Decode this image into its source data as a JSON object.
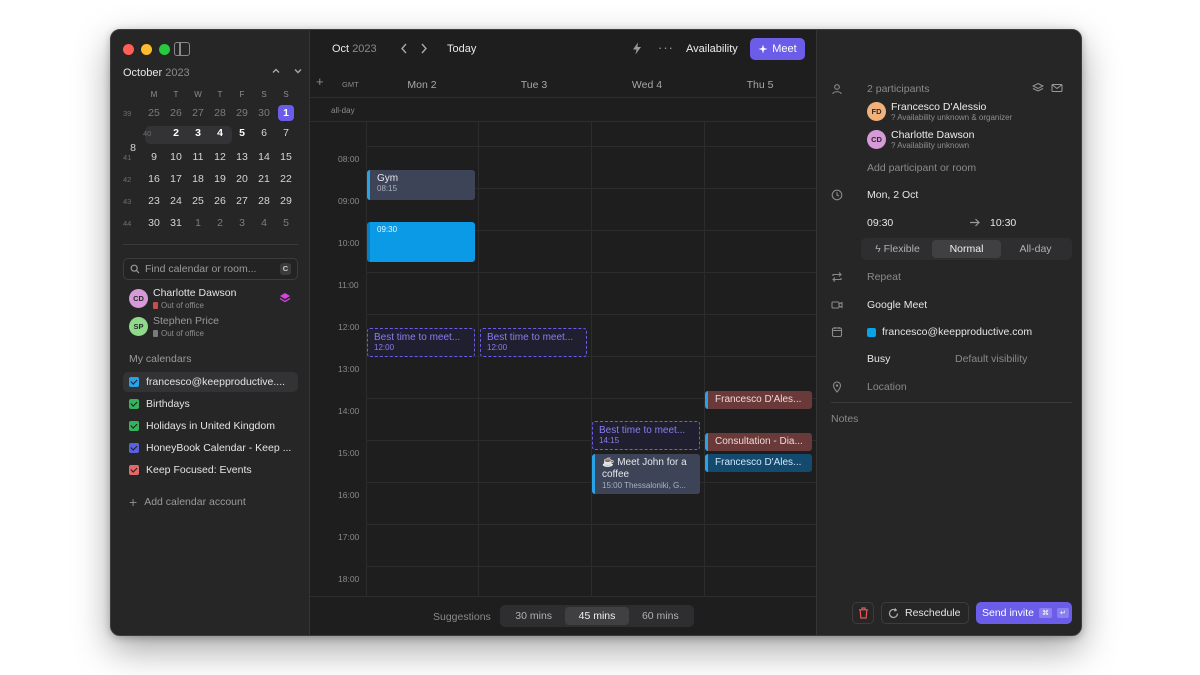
{
  "sidebar": {
    "mini": {
      "month": "October",
      "year": "2023",
      "dows": [
        "M",
        "T",
        "W",
        "T",
        "F",
        "S",
        "S"
      ],
      "weeks": [
        {
          "num": "39",
          "days": [
            "25",
            "26",
            "27",
            "28",
            "29",
            "30",
            "1"
          ]
        },
        {
          "num": "40",
          "days": [
            "2",
            "3",
            "4",
            "5",
            "6",
            "7",
            "8"
          ]
        },
        {
          "num": "41",
          "days": [
            "9",
            "10",
            "11",
            "12",
            "13",
            "14",
            "15"
          ]
        },
        {
          "num": "42",
          "days": [
            "16",
            "17",
            "18",
            "19",
            "20",
            "21",
            "22"
          ]
        },
        {
          "num": "43",
          "days": [
            "23",
            "24",
            "25",
            "26",
            "27",
            "28",
            "29"
          ]
        },
        {
          "num": "44",
          "days": [
            "30",
            "31",
            "1",
            "2",
            "3",
            "4",
            "5"
          ]
        }
      ]
    },
    "search": {
      "placeholder": "Find calendar or room...",
      "shortcut": "C"
    },
    "people": [
      {
        "initials": "CD",
        "name": "Charlotte Dawson",
        "status": "Out of office",
        "color": "#d79ad8"
      },
      {
        "initials": "SP",
        "name": "Stephen Price",
        "status": "Out of office",
        "color": "#8fd98a"
      }
    ],
    "calendars_label": "My calendars",
    "calendars": [
      {
        "label": "francesco@keepproductive....",
        "color": "#2aa2e8"
      },
      {
        "label": "Birthdays",
        "color": "#34b35a"
      },
      {
        "label": "Holidays in United Kingdom",
        "color": "#34b35a"
      },
      {
        "label": "HoneyBook Calendar - Keep ...",
        "color": "#5a62dd"
      },
      {
        "label": "Keep Focused: Events",
        "color": "#e06a6a"
      }
    ],
    "add_account": "Add calendar account"
  },
  "main": {
    "toolbar": {
      "month": "Oct",
      "year": "2023",
      "today": "Today",
      "more": "···",
      "availability": "Availability",
      "meet": "Meet"
    },
    "gmt": "GMT",
    "days": [
      "Mon 2",
      "Tue 3",
      "Wed 4",
      "Thu 5"
    ],
    "allday": "all-day",
    "hours": [
      "08:00",
      "09:00",
      "10:00",
      "11:00",
      "12:00",
      "13:00",
      "14:00",
      "15:00",
      "16:00",
      "17:00",
      "18:00"
    ],
    "events": {
      "gym": {
        "title": "Gym",
        "time": "08:15"
      },
      "new_event": {
        "time": "09:30"
      },
      "best1": {
        "title": "Best time to meet...",
        "time": "12:00"
      },
      "best2": {
        "title": "Best time to meet...",
        "time": "12:00"
      },
      "best3": {
        "title": "Best time to meet...",
        "time": "14:15"
      },
      "coffee": {
        "title": "☕ Meet John for a coffee",
        "time": "15:00 Thessaloniki, G..."
      },
      "fd1": {
        "title": "Francesco D'Ales..."
      },
      "consult": {
        "title": "Consultation - Dia..."
      },
      "fd2": {
        "title": "Francesco D'Ales..."
      }
    },
    "suggestions": {
      "label": "Suggestions",
      "options": [
        "30 mins",
        "45 mins",
        "60 mins"
      ],
      "selected": "45 mins"
    }
  },
  "panel": {
    "participants_count": "2 participants",
    "participants": [
      {
        "initials": "FD",
        "name": "Francesco D'Alessio",
        "sub": "Availability unknown & organizer",
        "color": "#f2b07a"
      },
      {
        "initials": "CD",
        "name": "Charlotte Dawson",
        "sub": "Availability unknown",
        "color": "#d79ad8"
      }
    ],
    "add_participant": "Add participant or room",
    "date": "Mon, 2 Oct",
    "start": "09:30",
    "end": "10:30",
    "modes": [
      "Flexible",
      "Normal",
      "All-day"
    ],
    "mode_selected": "Normal",
    "repeat": "Repeat",
    "conference": "Google Meet",
    "calendar": "francesco@keepproductive.com",
    "calendar_color": "#0ba2e6",
    "busy": "Busy",
    "visibility": "Default visibility",
    "location": "Location",
    "notes": "Notes",
    "reschedule": "Reschedule",
    "send": "Send invite"
  }
}
